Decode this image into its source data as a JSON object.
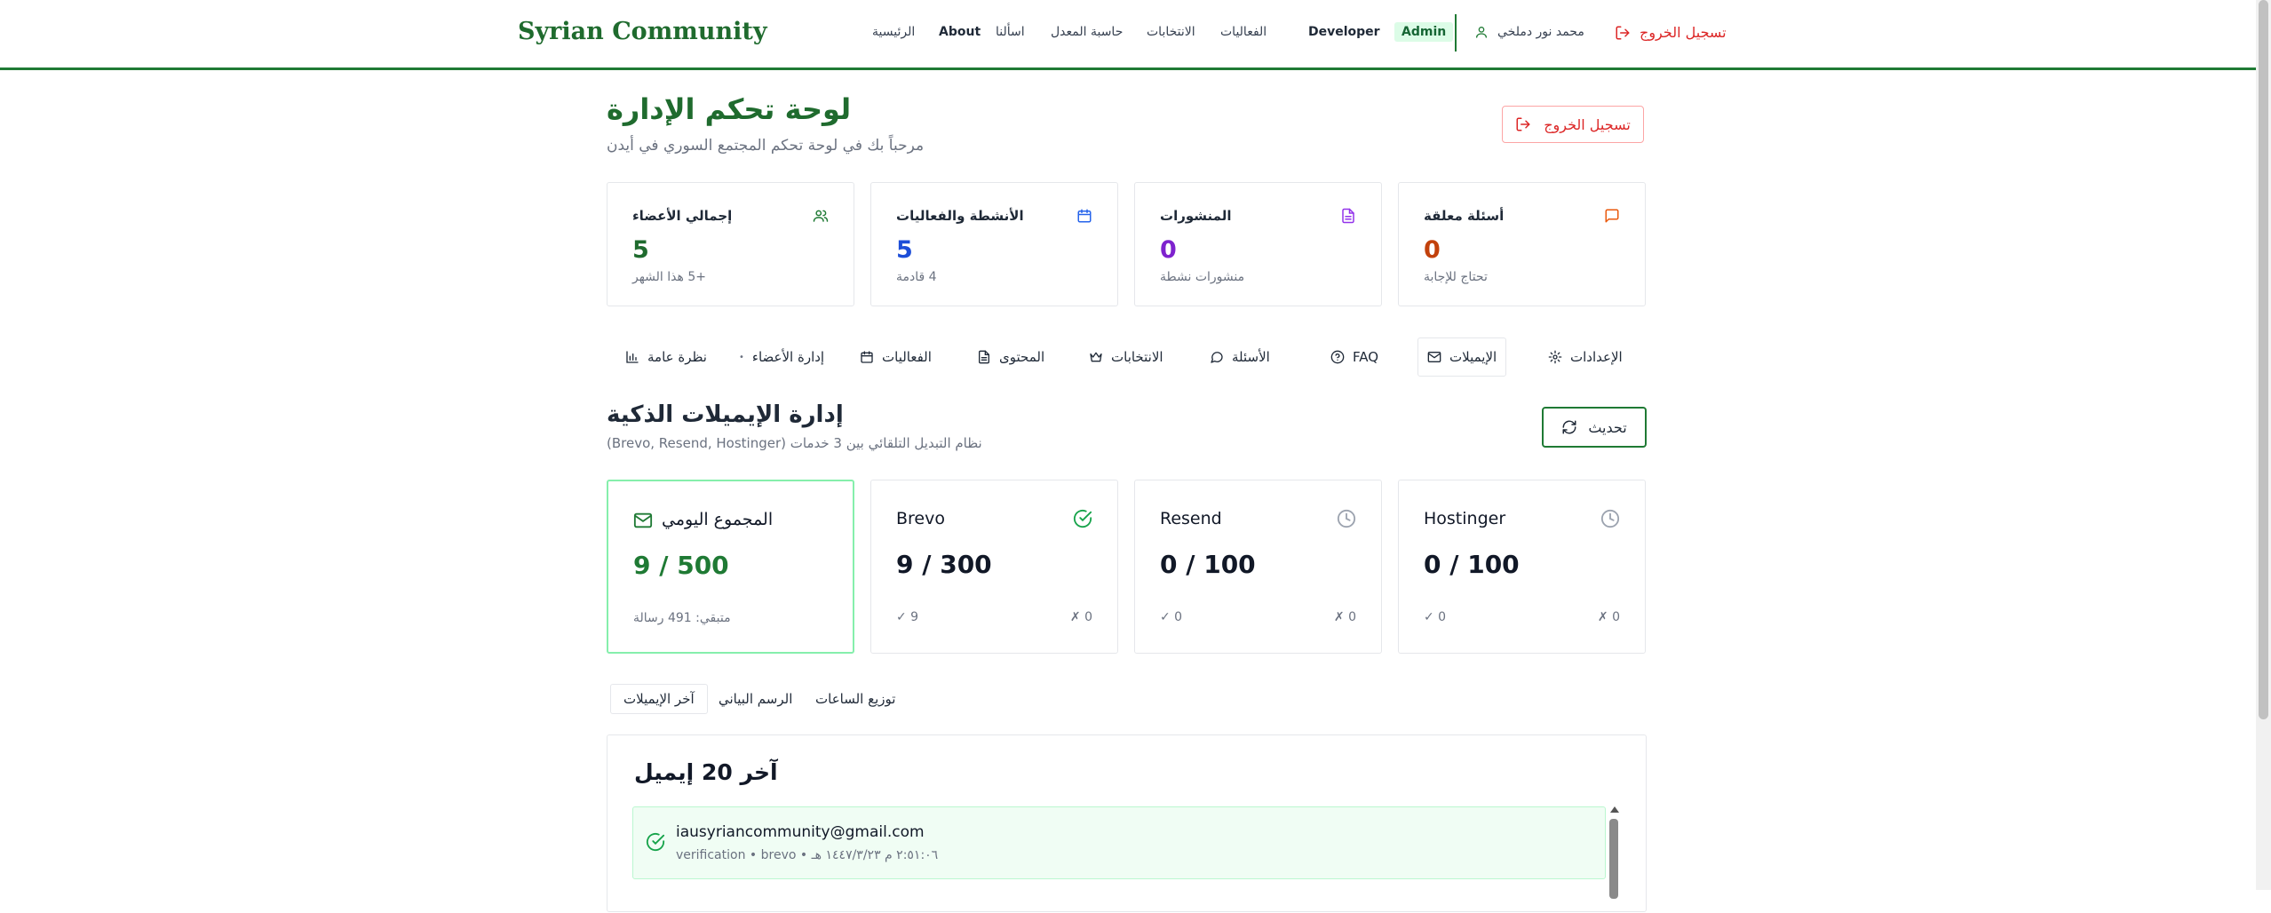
{
  "header": {
    "logo": "Syrian Community",
    "nav": [
      {
        "label": "الرئيسية"
      },
      {
        "label": "About"
      },
      {
        "label": "اسألنا"
      },
      {
        "label": "حاسبة المعدل"
      },
      {
        "label": "الانتخابات"
      },
      {
        "label": "الفعاليات"
      },
      {
        "label": "Developer"
      }
    ],
    "admin_badge": "Admin",
    "user_name": "محمد نور دملخي",
    "logout": "تسجيل الخروج"
  },
  "page": {
    "title": "لوحة تحكم الإدارة",
    "subtitle": "مرحباً بك في لوحة تحكم المجتمع السوري في أيدن",
    "logout_button": "تسجيل الخروج"
  },
  "stats": [
    {
      "title": "إجمالي الأعضاء",
      "value": "5",
      "sub": "+5 هذا الشهر",
      "color": "#1f6b2e",
      "icon": "users-icon"
    },
    {
      "title": "الأنشطة والفعاليات",
      "value": "5",
      "sub": "4 قادمة",
      "color": "#1d4ed8",
      "icon": "calendar-icon"
    },
    {
      "title": "المنشورات",
      "value": "0",
      "sub": "منشورات نشطة",
      "color": "#7e22ce",
      "icon": "document-icon"
    },
    {
      "title": "أسئلة معلقة",
      "value": "0",
      "sub": "تحتاج للإجابة",
      "color": "#c2410c",
      "icon": "chat-icon"
    }
  ],
  "tabs": [
    {
      "label": "نظرة عامة",
      "icon": "chart-icon"
    },
    {
      "label": "إدارة الأعضاء",
      "icon": "dot-icon"
    },
    {
      "label": "الفعاليات",
      "icon": "calendar-icon"
    },
    {
      "label": "المحتوى",
      "icon": "document-icon"
    },
    {
      "label": "الانتخابات",
      "icon": "crown-icon"
    },
    {
      "label": "الأسئلة",
      "icon": "chat-icon"
    },
    {
      "label": "FAQ",
      "icon": "help-icon"
    },
    {
      "label": "الإيميلات",
      "icon": "mail-icon",
      "active": true
    },
    {
      "label": "الإعدادات",
      "icon": "gear-icon"
    }
  ],
  "email_section": {
    "title": "إدارة الإيميلات الذكية",
    "subtitle": "(Brevo, Resend, Hostinger) نظام التبديل التلقائي بين 3 خدمات",
    "refresh": "تحديث"
  },
  "email_cards": {
    "total": {
      "label": "المجموع اليومي",
      "value": "9 / 500",
      "remaining": "متبقي: 491 رسالة"
    },
    "providers": [
      {
        "name": "Brevo",
        "value": "9 / 300",
        "ok": "✓ 9",
        "fail": "✗ 0",
        "status": "check-circle-icon"
      },
      {
        "name": "Resend",
        "value": "0 / 100",
        "ok": "✓ 0",
        "fail": "✗ 0",
        "status": "clock-icon"
      },
      {
        "name": "Hostinger",
        "value": "0 / 100",
        "ok": "✓ 0",
        "fail": "✗ 0",
        "status": "clock-icon"
      }
    ]
  },
  "sub_tabs": [
    {
      "label": "آخر الإيميلات",
      "active": true
    },
    {
      "label": "الرسم البياني"
    },
    {
      "label": "توزيع الساعات"
    }
  ],
  "recent": {
    "title": "آخر 20 إيميل",
    "items": [
      {
        "email": "iausyriancommunity@gmail.com",
        "meta": "verification • brevo • ٢:٥١:٠٦ م ١٤٤٧/٣/٢٣ هـ"
      }
    ]
  },
  "colors": {
    "brand": "#1f6b2e",
    "danger": "#dc2626"
  }
}
